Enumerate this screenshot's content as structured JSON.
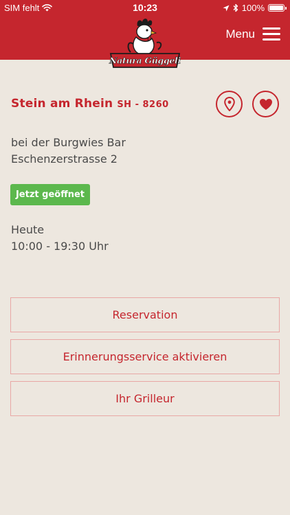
{
  "status_bar": {
    "carrier": "SIM fehlt",
    "time": "10:23",
    "battery": "100%"
  },
  "header": {
    "logo_text": "Natura Güggeli",
    "menu_label": "Menu"
  },
  "location": {
    "name": "Stein am Rhein",
    "postal": "SH - 8260",
    "address_line1": "bei der Burgwies Bar",
    "address_line2": "Eschenzerstrasse 2",
    "status_badge": "Jetzt geöffnet",
    "day_label": "Heute",
    "hours": "10:00 - 19:30 Uhr"
  },
  "actions": {
    "reservation": "Reservation",
    "reminder": "Erinnerungsservice aktivieren",
    "griller": "Ihr Grilleur"
  },
  "colors": {
    "brand_red": "#c5262e",
    "background": "#ede7df",
    "open_green": "#5cb84d",
    "text": "#4a4a4a",
    "button_border": "#e8a7a5"
  },
  "icons": {
    "wifi": "wifi-icon",
    "location_arrow": "location-arrow-icon",
    "bluetooth": "bluetooth-icon",
    "battery": "battery-icon",
    "map_pin": "map-pin-icon",
    "heart": "heart-icon",
    "hamburger": "hamburger-icon"
  }
}
